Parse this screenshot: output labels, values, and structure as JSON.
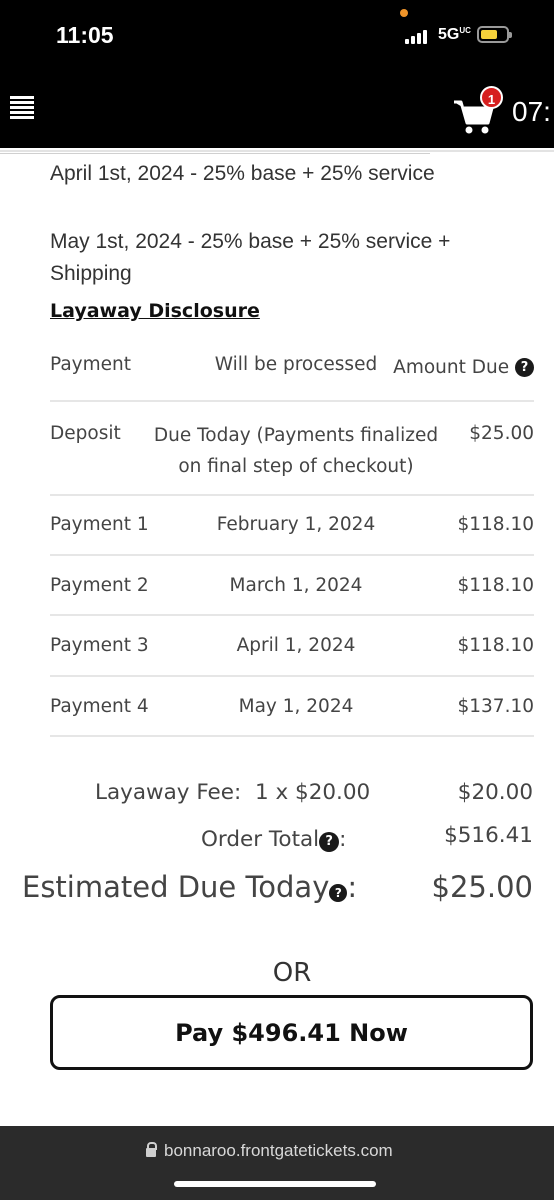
{
  "status_bar": {
    "time": "11:05",
    "network": "5G",
    "network_suffix": "UC"
  },
  "header": {
    "cart_count": "1",
    "timer": "07:"
  },
  "schedule_lines": [
    "April 1st, 2024 - 25% base + 25% service",
    "May 1st, 2024 - 25% base + 25% service + Shipping"
  ],
  "disclosure_title": "Layaway Disclosure",
  "table": {
    "headers": {
      "payment": "Payment",
      "processed": "Will be processed",
      "amount": "Amount Due"
    },
    "rows": [
      {
        "payment": "Deposit",
        "processed": "Due Today (Payments finalized on final step of checkout)",
        "amount": "$25.00"
      },
      {
        "payment": "Payment 1",
        "processed": "February 1, 2024",
        "amount": "$118.10"
      },
      {
        "payment": "Payment 2",
        "processed": "March 1, 2024",
        "amount": "$118.10"
      },
      {
        "payment": "Payment 3",
        "processed": "April 1, 2024",
        "amount": "$118.10"
      },
      {
        "payment": "Payment 4",
        "processed": "May 1, 2024",
        "amount": "$137.10"
      }
    ]
  },
  "summary": {
    "fee_label": "Layaway Fee:",
    "fee_qty": "1 x $20.00",
    "fee_value": "$20.00",
    "order_total_label": "Order Total",
    "order_total_value": "$516.41",
    "due_today_label": "Estimated Due Today",
    "due_today_value": "$25.00"
  },
  "or_text": "OR",
  "pay_button": "Pay $496.41 Now",
  "browser": {
    "url": "bonnaroo.frontgatetickets.com"
  },
  "colors": {
    "badge": "#d61f1f",
    "battery": "#f5d13b",
    "topbar": "#000000"
  },
  "icons": [
    "menu-icon",
    "cart-icon",
    "help-icon",
    "lock-icon"
  ]
}
